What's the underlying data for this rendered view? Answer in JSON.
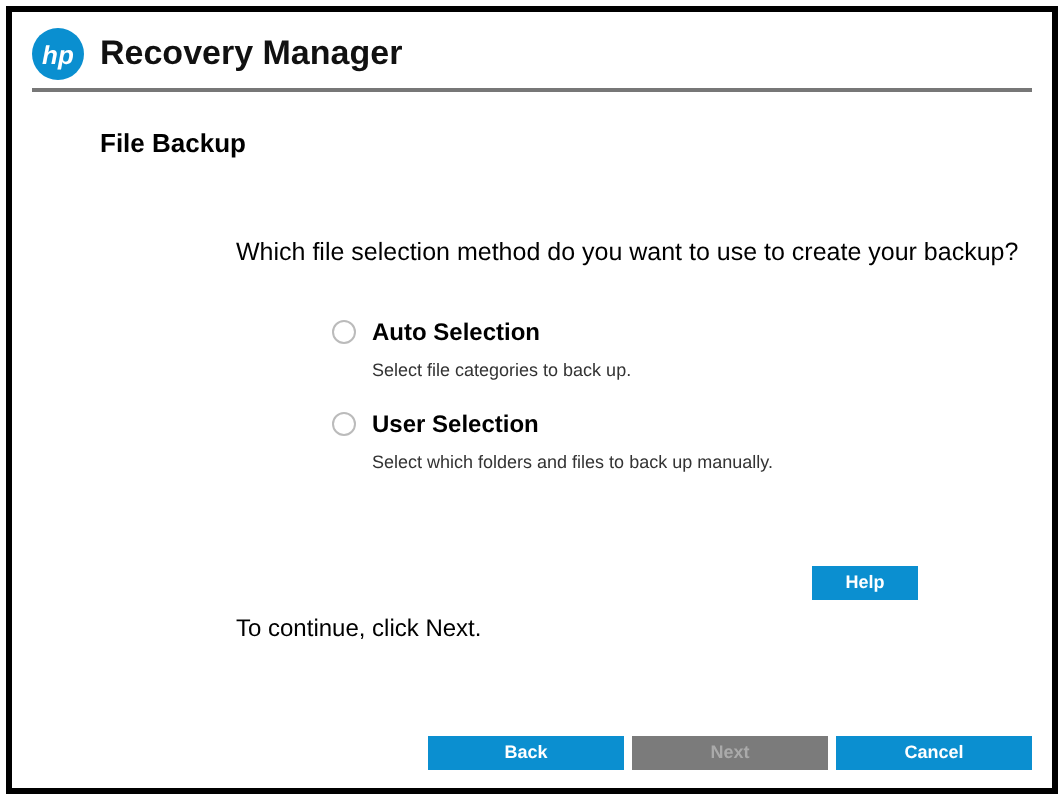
{
  "header": {
    "logo": "hp",
    "title": "Recovery Manager"
  },
  "page_title": "File Backup",
  "question": "Which file selection method do you want to use to create your backup?",
  "options": [
    {
      "label": "Auto Selection",
      "description": "Select file categories to back up.",
      "selected": false
    },
    {
      "label": "User Selection",
      "description": "Select which folders and files to back up manually.",
      "selected": false
    }
  ],
  "help_button": "Help",
  "instruction": "To continue, click Next.",
  "buttons": [
    {
      "label": "Back",
      "disabled": false
    },
    {
      "label": "Next",
      "disabled": true
    },
    {
      "label": "Cancel",
      "disabled": false
    }
  ]
}
